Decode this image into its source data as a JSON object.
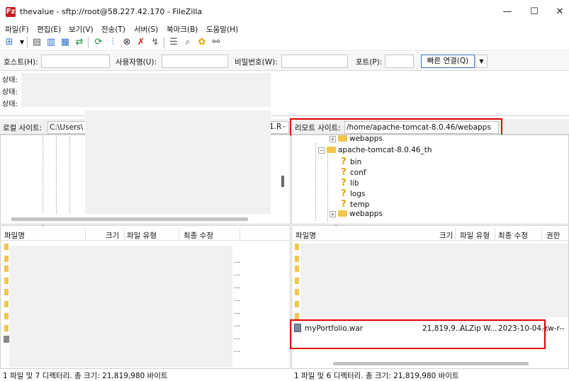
{
  "window": {
    "title": "thevalue - sftp://root@58.227.42.170 - FileZilla",
    "app_icon": "filezilla-icon",
    "app_icon_letter": "Fz",
    "minimize": "—",
    "maximize": "☐",
    "close": "✕"
  },
  "menu": [
    "파일(F)",
    "편집(E)",
    "보기(V)",
    "전송(T)",
    "서버(S)",
    "북마크(B)",
    "도움말(H)"
  ],
  "quickconnect": {
    "host_label": "호스트(H):",
    "user_label": "사용자명(U):",
    "pass_label": "비밀번호(W):",
    "port_label": "포트(P):",
    "button_label": "빠른 연결(Q)",
    "dropdown_icon": "▼"
  },
  "log": [
    "상태:",
    "상태:",
    "상태:"
  ],
  "local": {
    "label": "로컬 사이트:",
    "path": "C:\\Users\\",
    "path_suffix": "1.R",
    "columns": [
      "파일명",
      "크기",
      "파일 유형",
      "최종 수정"
    ],
    "status": "1 파일 및 7 디렉터리. 총 크기: 21,819,980 바이트"
  },
  "remote": {
    "label": "리모트 사이트:",
    "path": "/home/apache-tomcat-8.0.46/webapps",
    "tree": [
      {
        "name": "webapps",
        "type": "folder",
        "expander": "+"
      },
      {
        "name": "apache-tomcat-8.0.46_th",
        "type": "folder",
        "expander": "−"
      },
      {
        "name": "bin",
        "type": "unknown"
      },
      {
        "name": "conf",
        "type": "unknown"
      },
      {
        "name": "lib",
        "type": "unknown"
      },
      {
        "name": "logs",
        "type": "unknown"
      },
      {
        "name": "temp",
        "type": "unknown"
      },
      {
        "name": "webapps",
        "type": "folder",
        "expander": "+"
      }
    ],
    "columns": [
      "파일명",
      "크기",
      "파일 유형",
      "최종 수정",
      "권한"
    ],
    "file": {
      "name": "myPortfolio.war",
      "size": "21,819,9...",
      "type": "ALZip W...",
      "modified": "2023-10-04...",
      "perm": "-rw-r--"
    },
    "status": "1 파일 및 6 디렉터리. 총 크기: 21,819,980 바이트"
  },
  "colors": {
    "highlight": "#e00000",
    "folder": "#f3c64b",
    "accent": "#3a73c8"
  }
}
